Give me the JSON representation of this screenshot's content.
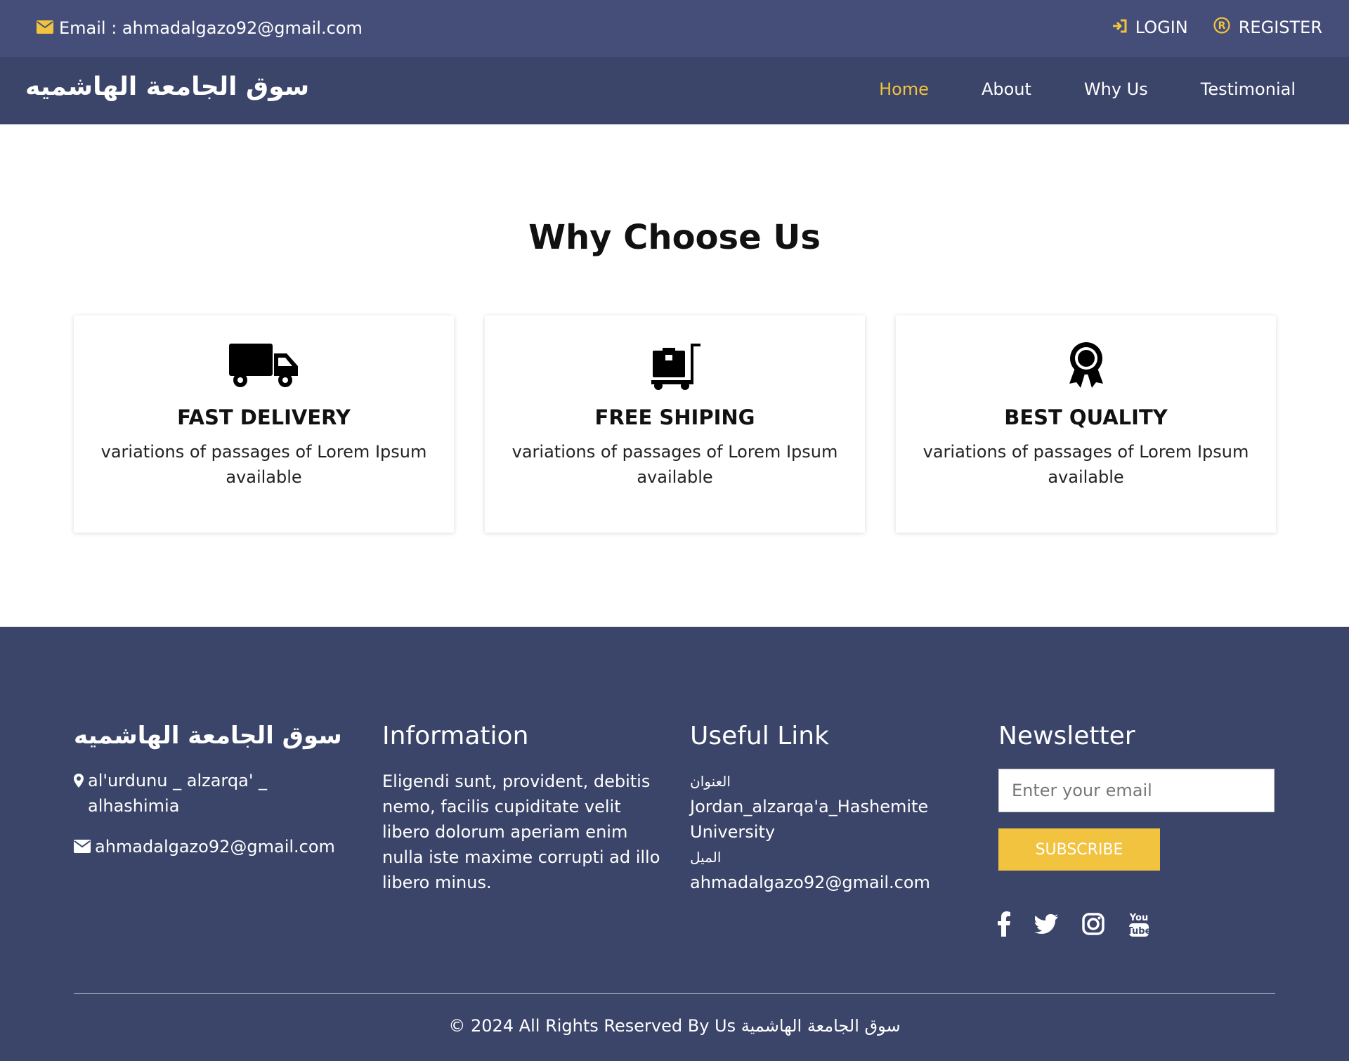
{
  "colors": {
    "topbar": "#454e79",
    "navbar": "#3b4469",
    "accent": "#f2c33f",
    "footer": "#3b4469"
  },
  "topbar": {
    "email_text": "Email : ahmadalgazo92@gmail.com",
    "login_label": "LOGIN",
    "register_label": "REGISTER"
  },
  "nav": {
    "brand": "سوق الجامعة الهاشميه",
    "items": [
      {
        "label": "Home",
        "active": true
      },
      {
        "label": "About"
      },
      {
        "label": "Why Us"
      },
      {
        "label": "Testimonial"
      }
    ]
  },
  "why": {
    "title": "Why Choose Us",
    "cards": [
      {
        "icon": "truck-icon",
        "title": "FAST DELIVERY",
        "text": "variations of passages of Lorem Ipsum available"
      },
      {
        "icon": "cart-icon",
        "title": "FREE SHIPING",
        "text": "variations of passages of Lorem Ipsum available"
      },
      {
        "icon": "award-icon",
        "title": "BEST QUALITY",
        "text": "variations of passages of Lorem Ipsum available"
      }
    ]
  },
  "footer": {
    "brand": "سوق الجامعة الهاشميه",
    "address": "al'urdunu _ alzarqa' _ alhashimia",
    "email": "ahmadalgazo92@gmail.com",
    "info_title": "Information",
    "info_text": "Eligendi sunt, provident, debitis nemo, facilis cupiditate velit libero dolorum aperiam enim nulla iste maxime corrupti ad illo libero minus.",
    "links_title": "Useful Link",
    "address_label": "العنوان",
    "address_value": "Jordan_alzarqa'a_Hashemite University",
    "email_label": "الميل",
    "email_value": "ahmadalgazo92@gmail.com",
    "newsletter_title": "Newsletter",
    "newsletter_placeholder": "Enter your email",
    "subscribe_label": "SUBSCRIBE",
    "socials": [
      "facebook-icon",
      "twitter-icon",
      "instagram-icon",
      "youtube-icon"
    ],
    "copyright": "© 2024 All Rights Reserved By Us سوق الجامعة الهاشمية"
  }
}
